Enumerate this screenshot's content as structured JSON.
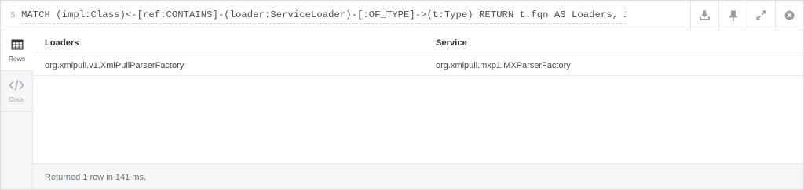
{
  "query": {
    "prompt": "$",
    "text": "MATCH (impl:Class)<-[ref:CONTAINS]-(loader:ServiceLoader)-[:OF_TYPE]->(t:Type) RETURN t.fqn AS Loaders, impl.fqn AS Service"
  },
  "actions": [
    {
      "name": "download-icon"
    },
    {
      "name": "pin-icon"
    },
    {
      "name": "expand-icon"
    },
    {
      "name": "close-icon"
    }
  ],
  "tabs": [
    {
      "label": "Rows",
      "icon": "table-icon",
      "active": true
    },
    {
      "label": "Code",
      "icon": "code-icon",
      "active": false
    }
  ],
  "table": {
    "columns": [
      "Loaders",
      "Service"
    ],
    "rows": [
      [
        "org.xmlpull.v1.XmlPullParserFactory",
        "org.xmlpull.mxp1.MXParserFactory"
      ]
    ]
  },
  "status": "Returned 1 row in 141 ms.",
  "colors": {
    "accent_dark": "#2d3338",
    "muted_icon": "#959da3",
    "border": "#e3e6e9"
  }
}
